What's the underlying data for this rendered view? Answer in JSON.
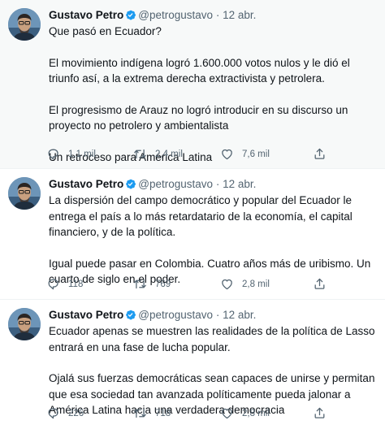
{
  "tweets": [
    {
      "author": "Gustavo Petro",
      "handle": "@petrogustavo",
      "separator": "·",
      "date": "12 abr.",
      "paragraphs": [
        "Que pasó en Ecuador?",
        "El movimiento indígena logró 1.600.000 votos nulos y le dió el triunfo así, a la extrema derecha extractivista y petrolera.",
        "El progresismo de Arauz no logró introducir en su discurso un proyecto no petrolero y ambientalista",
        "Un retroceso para América Latina"
      ],
      "replies": "1,1 mil",
      "retweets": "2,4 mil",
      "likes": "7,6 mil"
    },
    {
      "author": "Gustavo Petro",
      "handle": "@petrogustavo",
      "separator": "·",
      "date": "12 abr.",
      "paragraphs": [
        "La dispersión del campo democrático y popular del Ecuador le entrega el país a lo más retardatario de la economía, el capital financiero, y de la política.",
        "Igual puede pasar en Colombia. Cuatro años más de uribismo. Un cuarto de siglo en el poder."
      ],
      "replies": "118",
      "retweets": "769",
      "likes": "2,8 mil"
    },
    {
      "author": "Gustavo Petro",
      "handle": "@petrogustavo",
      "separator": "·",
      "date": "12 abr.",
      "paragraphs": [
        "Ecuador apenas se muestren las realidades de la política de Lasso entrará en una fase de lucha popular.",
        "Ojalá sus fuerzas democráticas sean capaces de unirse y permitan que esa sociedad tan avanzada políticamente pueda jalonar a América Latina hacia una verdadera democracia"
      ],
      "replies": "226",
      "retweets": "718",
      "likes": "2,8 mil"
    }
  ],
  "colors": {
    "verified": "#1d9bf0",
    "text": "#0f1419",
    "secondary": "#536471",
    "highlight_bg": "#f7f9f9"
  }
}
